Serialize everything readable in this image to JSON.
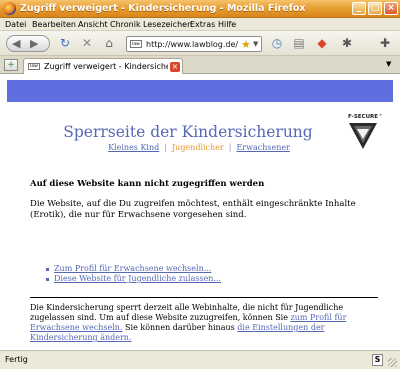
{
  "window": {
    "title": "Zugriff verweigert - Kindersicherung - Mozilla Firefox",
    "buttons": {
      "minimize": "_",
      "maximize": "□",
      "close": "×"
    }
  },
  "menu": [
    "Datei",
    "Bearbeiten",
    "Ansicht",
    "Chronik",
    "Lesezeichen",
    "Extras",
    "Hilfe"
  ],
  "toolbar": {
    "url": "http://www.lawblog.de/",
    "favicon_text": "law"
  },
  "tab": {
    "label": "Zugriff verweigert - Kindersicher...",
    "favicon_text": "law"
  },
  "page": {
    "heading": "Sperrseite der Kindersicherung",
    "profiles": [
      {
        "label": "Kleines Kind",
        "active": false
      },
      {
        "label": "Jugendlicher",
        "active": true
      },
      {
        "label": "Erwachsener",
        "active": false
      }
    ],
    "logo_text": "F-SECURE",
    "blocked_title": "Auf diese Website kann nicht zugegriffen werden",
    "description": "Die Website, auf die Du zugreifen möchtest, enthält eingeschränkte Inhalte (Erotik), die nur für Erwachsene vorgesehen sind.",
    "actions": [
      "Zum Profil für Erwachsene wechseln...",
      "Diese Website für Jugendliche zulassen..."
    ],
    "footer": {
      "text1": "Die Kindersicherung sperrt derzeit alle Webinhalte, die nicht für Jugendliche zugelassen sind. Um auf diese Website zuzugreifen, können Sie ",
      "link1": "zum Profil für Erwachsene wechseln.",
      "text2": " Sie können darüber hinaus ",
      "link2": "die Einstellungen der Kindersicherung ändern."
    }
  },
  "status": {
    "text": "Fertig"
  },
  "colors": {
    "accent_blue": "#5f6fe0",
    "heading": "#5568b5",
    "active_profile": "#e59a2c"
  }
}
